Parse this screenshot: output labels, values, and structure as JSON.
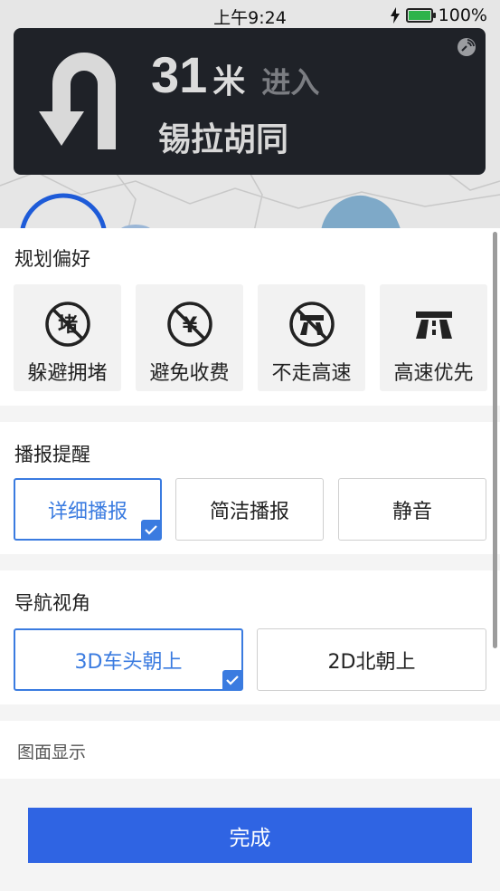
{
  "status_bar": {
    "time": "上午9:24",
    "battery_percent": "100%",
    "battery_level": 1.0,
    "icons": [
      "charging-bolt-icon",
      "battery-icon"
    ]
  },
  "navigation": {
    "maneuver_icon": "u-turn-icon",
    "distance_value": "31",
    "distance_unit": "米",
    "action": "进入",
    "road_name": "锡拉胡同",
    "gps_icon": "satellite-signal-icon"
  },
  "route_preference": {
    "title": "规划偏好",
    "options": [
      {
        "label": "躲避拥堵",
        "icon": "avoid-congestion-icon"
      },
      {
        "label": "避免收费",
        "icon": "avoid-toll-icon"
      },
      {
        "label": "不走高速",
        "icon": "no-highway-icon"
      },
      {
        "label": "高速优先",
        "icon": "highway-first-icon"
      }
    ]
  },
  "broadcast": {
    "title": "播报提醒",
    "options": [
      {
        "label": "详细播报",
        "selected": true
      },
      {
        "label": "简洁播报",
        "selected": false
      },
      {
        "label": "静音",
        "selected": false
      }
    ]
  },
  "nav_view": {
    "title": "导航视角",
    "options": [
      {
        "label": "3D车头朝上",
        "selected": true
      },
      {
        "label": "2D北朝上",
        "selected": false
      }
    ]
  },
  "display": {
    "title": "图面显示"
  },
  "done_button": "完成",
  "colors": {
    "accent": "#3a7be0",
    "primary_button": "#2f64e3",
    "nav_card_bg": "#1f2228"
  }
}
